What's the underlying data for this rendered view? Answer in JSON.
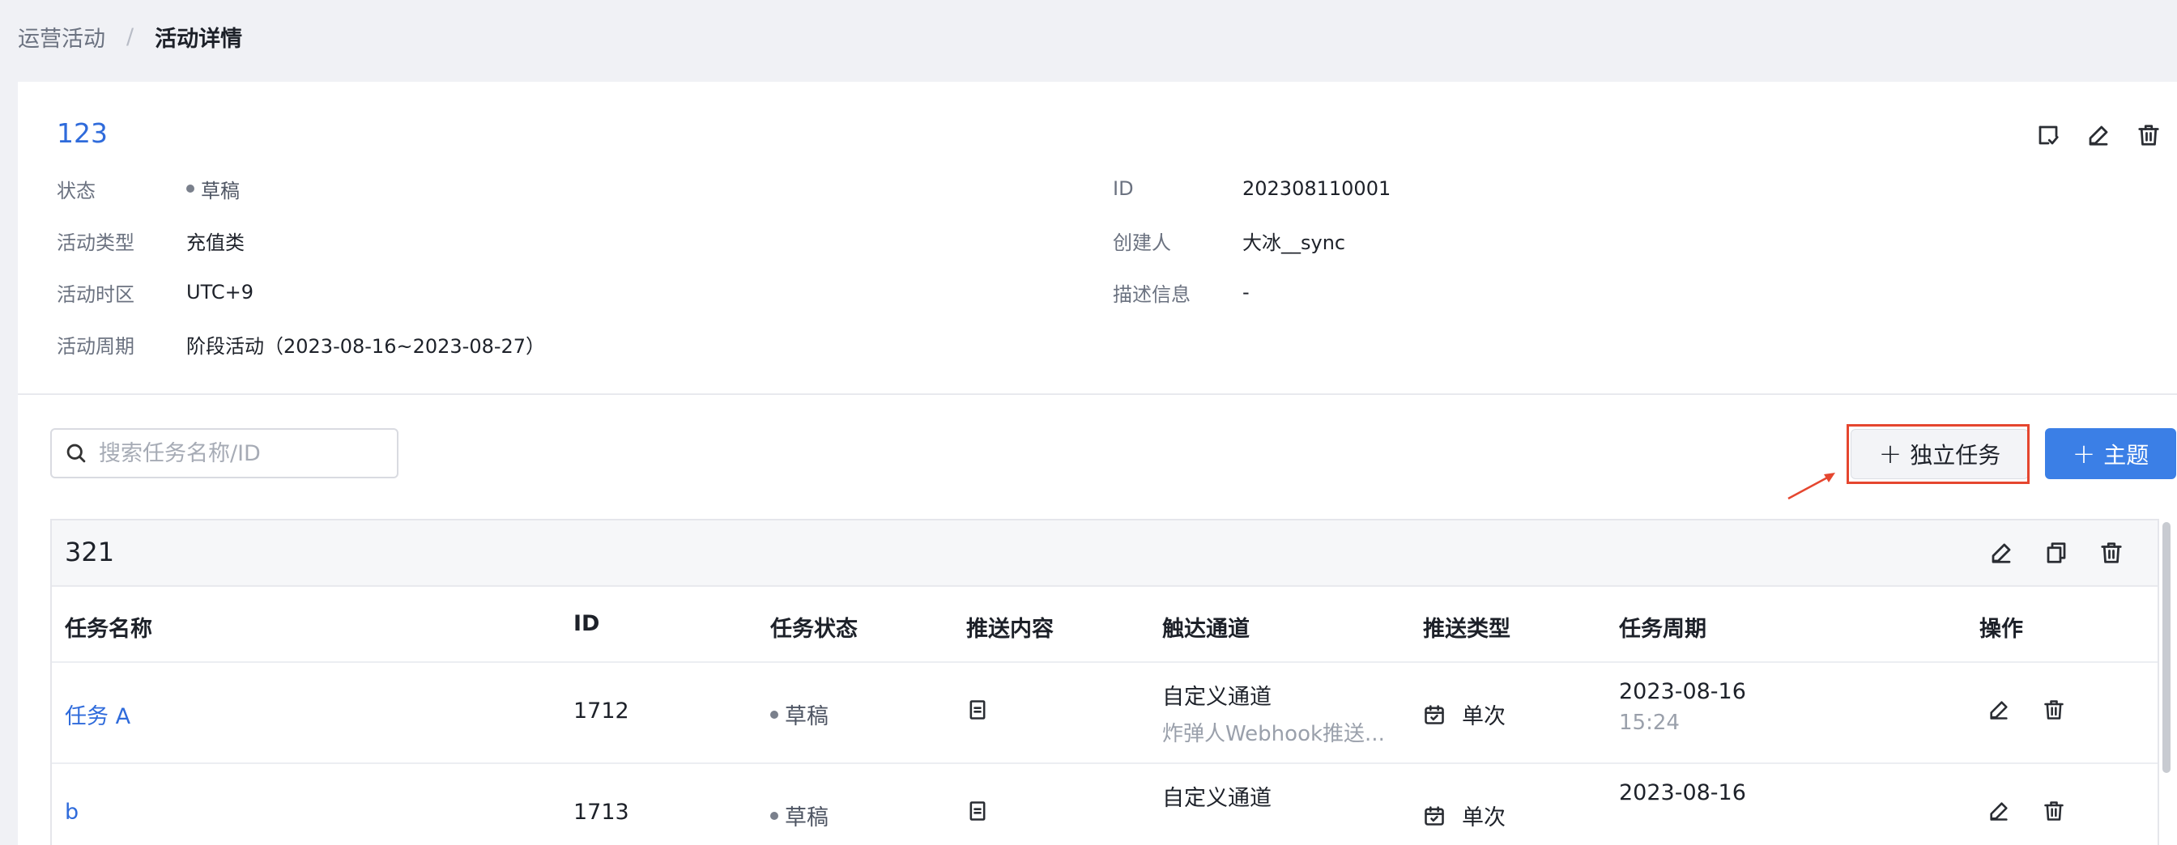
{
  "breadcrumb": {
    "parent": "运营活动",
    "separator": "/",
    "current": "活动详情"
  },
  "activity": {
    "title": "123",
    "fields_left": [
      {
        "label": "状态",
        "value": "草稿",
        "dot": true
      },
      {
        "label": "活动类型",
        "value": "充值类"
      },
      {
        "label": "活动时区",
        "value": "UTC+9"
      },
      {
        "label": "活动周期",
        "value": "阶段活动（2023-08-16~2023-08-27）"
      }
    ],
    "fields_right": [
      {
        "label": "ID",
        "value": "202308110001"
      },
      {
        "label": "创建人",
        "value": "大冰__sync"
      },
      {
        "label": "描述信息",
        "value": "-"
      }
    ],
    "header_icons": [
      "checklist-icon",
      "edit-icon",
      "delete-icon"
    ]
  },
  "search": {
    "placeholder": "搜索任务名称/ID",
    "value": ""
  },
  "buttons": {
    "standalone_task": "独立任务",
    "topic": "主题",
    "plus": "+"
  },
  "topic_panel": {
    "title": "321",
    "columns": [
      "任务名称",
      "ID",
      "任务状态",
      "推送内容",
      "触达通道",
      "推送类型",
      "任务周期",
      "操作"
    ],
    "rows": [
      {
        "name": "任务 A",
        "id": "1712",
        "status": "草稿",
        "channel": "自定义通道",
        "channel_sub": "炸弹人Webhook推送...",
        "push_type": "单次",
        "period_date": "2023-08-16",
        "period_time": "15:24"
      },
      {
        "name": "b",
        "id": "1713",
        "status": "草稿",
        "channel": "自定义通道",
        "channel_sub": "",
        "push_type": "单次",
        "period_date": "2023-08-16",
        "period_time": ""
      }
    ]
  },
  "colors": {
    "accent": "#3b7fe6",
    "link": "#2f6bdb",
    "highlight": "#e5462f"
  }
}
